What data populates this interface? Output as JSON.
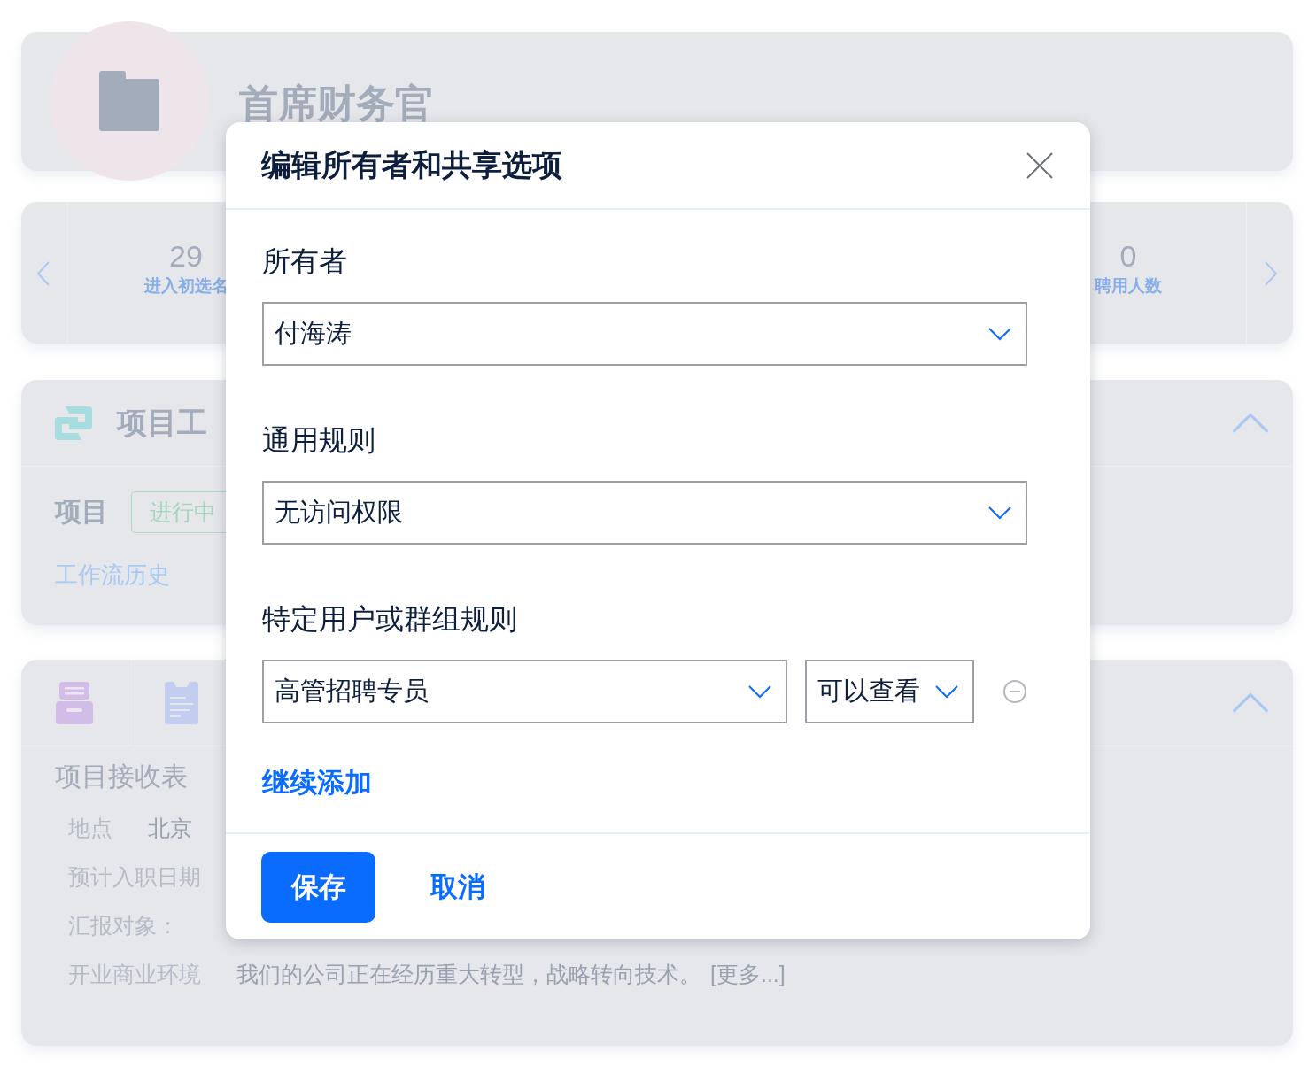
{
  "header": {
    "title": "首席财务官"
  },
  "stats": [
    {
      "value": "29",
      "label": "进入初选名"
    },
    {
      "value": "0",
      "label": "聘用人数"
    }
  ],
  "workflow": {
    "title": "项目工",
    "expanded": true,
    "project_label": "项目",
    "status": "进行中",
    "link": "工作流历史"
  },
  "intake": {
    "expanded": true,
    "tabs": [
      {
        "kind": "archive"
      },
      {
        "kind": "document"
      }
    ],
    "title": "项目接收表",
    "fields": [
      {
        "label": "地点",
        "value": "北京"
      },
      {
        "label": "预计入职日期"
      },
      {
        "label": "汇报对象："
      },
      {
        "label": "开业商业环境",
        "value": "我们的公司正在经历重大转型，战略转向技术。",
        "link": "[更多...]"
      }
    ]
  },
  "modal": {
    "title": "编辑所有者和共享选项",
    "owner": {
      "label": "所有者",
      "value": "付海涛"
    },
    "general_rule": {
      "label": "通用规则",
      "value": "无访问权限"
    },
    "specific_rules": {
      "label": "特定用户或群组规则",
      "rows": [
        {
          "user": "高管招聘专员",
          "permission": "可以查看"
        }
      ]
    },
    "add_link": "继续添加",
    "buttons": {
      "save": "保存",
      "cancel": "取消"
    }
  }
}
